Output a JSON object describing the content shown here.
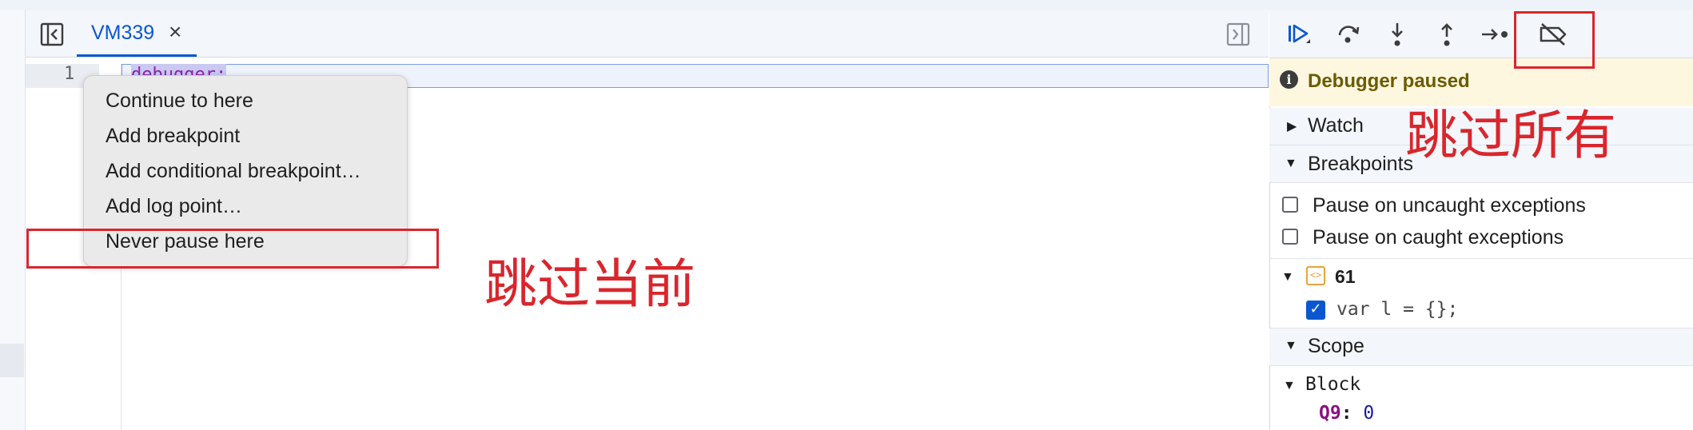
{
  "editor": {
    "tab_label": "VM339",
    "tab_close": "×",
    "line_number": "1",
    "code": "debugger;"
  },
  "context_menu": {
    "items": [
      "Continue to here",
      "Add breakpoint",
      "Add conditional breakpoint…",
      "Add log point…",
      "Never pause here"
    ]
  },
  "annotations": {
    "left": "跳过当前",
    "right": "跳过所有",
    "color": "#d9262c"
  },
  "sidebar": {
    "paused_text": "Debugger paused",
    "watch_label": "Watch",
    "breakpoints_label": "Breakpoints",
    "pause_uncaught": "Pause on uncaught exceptions",
    "pause_caught": "Pause on caught exceptions",
    "breakpoint_file": "61",
    "breakpoint_code": "var l = {};",
    "scope_label": "Scope",
    "block_label": "Block",
    "var_name": "Q9",
    "var_sep": ":",
    "var_value": "0"
  },
  "icons": {
    "toolbar": [
      "resume-icon",
      "step-over-icon",
      "step-into-icon",
      "step-out-icon",
      "step-icon",
      "deactivate-breakpoints-icon"
    ]
  },
  "colors": {
    "accent": "#0b57d0",
    "paused_banner": "#fef7e0"
  }
}
